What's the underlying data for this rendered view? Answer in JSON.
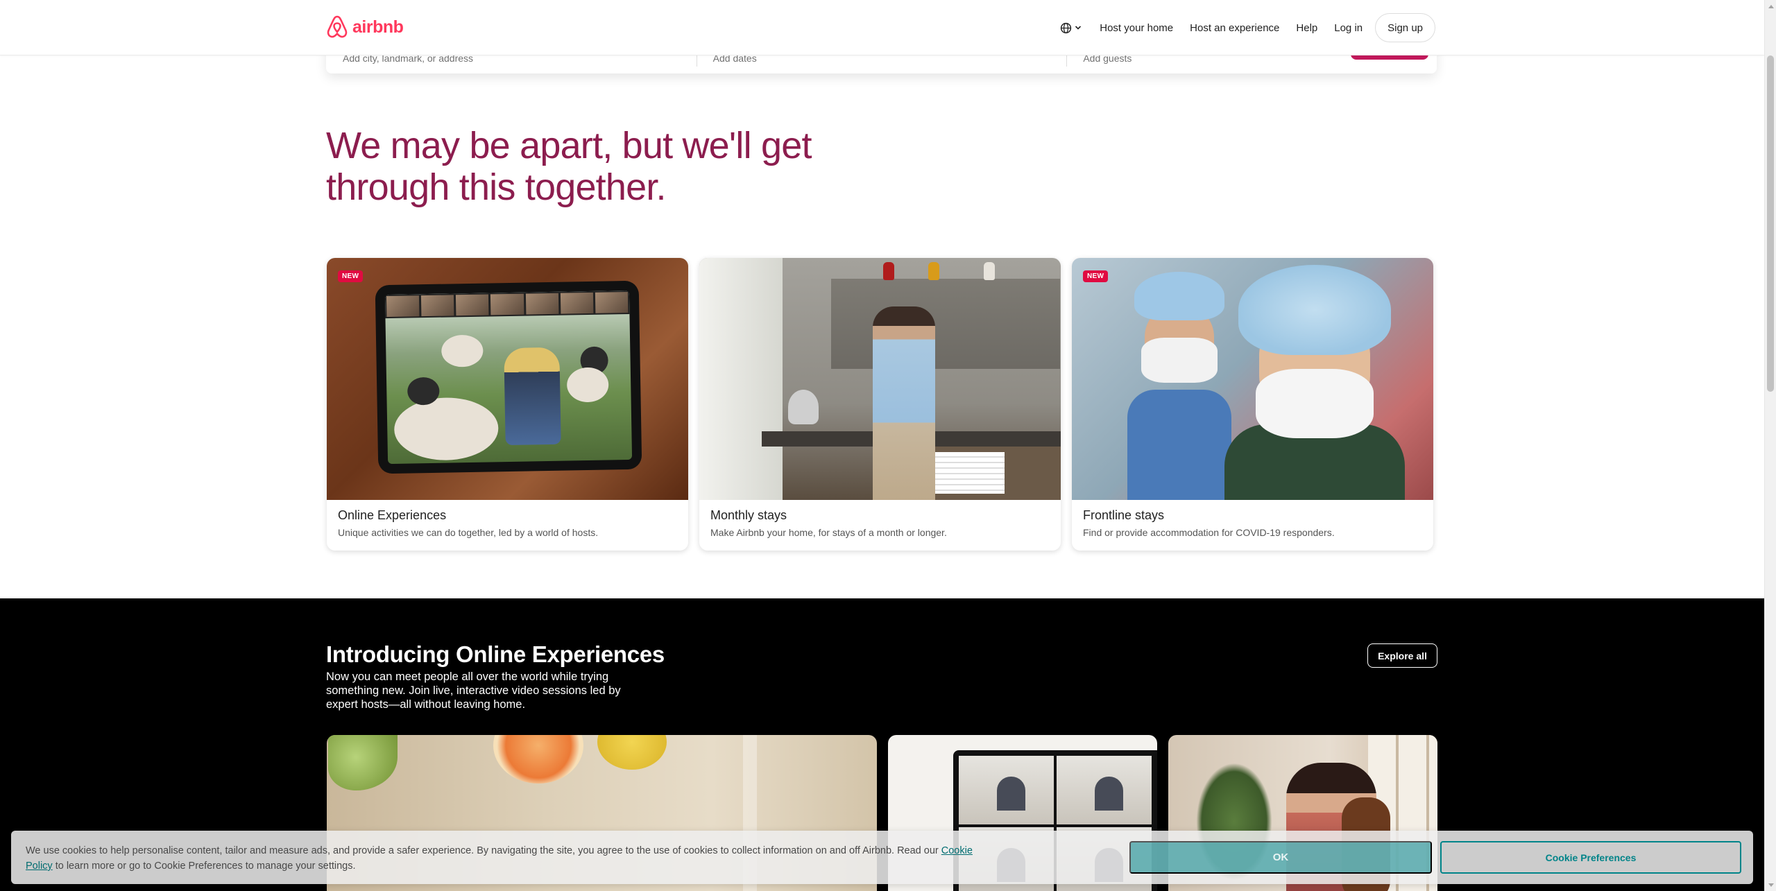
{
  "nav": {
    "logo_text": "airbnb",
    "links": {
      "host_home": "Host your home",
      "host_experience": "Host an experience",
      "help": "Help",
      "login": "Log in",
      "signup": "Sign up"
    },
    "icons": {
      "language": "globe-icon",
      "dropdown": "chevron-down-icon"
    }
  },
  "search": {
    "location_placeholder": "Add city, landmark, or address",
    "dates_placeholder": "Add dates",
    "guests_placeholder": "Add guests"
  },
  "hero": {
    "title": "We may be apart, but we'll get through this together."
  },
  "cards": [
    {
      "badge": "NEW",
      "title": "Online Experiences",
      "description": "Unique activities we can do together, led by a world of hosts."
    },
    {
      "badge": "",
      "title": "Monthly stays",
      "description": "Make Airbnb your home, for stays of a month or longer."
    },
    {
      "badge": "NEW",
      "title": "Frontline stays",
      "description": "Find or provide accommodation for COVID-19 responders."
    }
  ],
  "online_experiences": {
    "title": "Introducing Online Experiences",
    "description": "Now you can meet people all over the world while trying something new. Join live, interactive video sessions led by expert hosts—all without leaving home.",
    "explore_label": "Explore all"
  },
  "cookie_banner": {
    "text_before": "We use cookies to help personalise content, tailor and measure ads, and provide a safer experience. By navigating the site, you agree to the use of cookies to collect information on and off Airbnb. Read our ",
    "link_text": "Cookie Policy",
    "text_after": " to learn more or go to Cookie Preferences to manage your settings.",
    "ok_label": "OK",
    "preferences_label": "Cookie Preferences"
  },
  "colors": {
    "brand": "#FF385C",
    "hero_text": "#8c1d4e",
    "badge": "#e00b41",
    "teal": "#008489"
  }
}
